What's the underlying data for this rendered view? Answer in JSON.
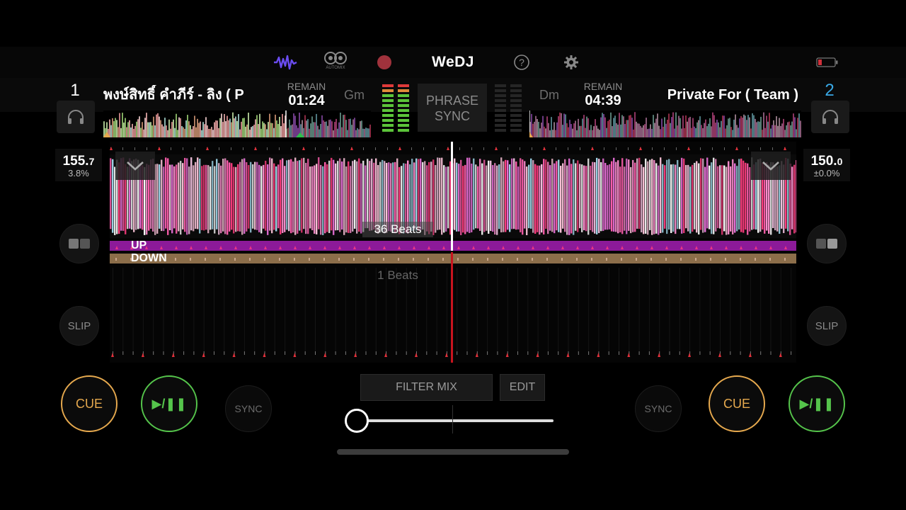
{
  "app": {
    "logo": "WeDJ",
    "automix_label": "AUTOMIX"
  },
  "colors": {
    "cue": "#e6a94e",
    "play": "#55c44b",
    "deck2_accent": "#39a9e6",
    "phrase_up": "#8c1a99",
    "phrase_down": "#8c6e4a",
    "playhead_lower": "#c8141e"
  },
  "icons": {
    "top": [
      "waveform-icon",
      "automix-icon",
      "record-icon",
      "help-icon",
      "settings-icon",
      "battery-icon"
    ],
    "deck": [
      "headphones-icon",
      "chevron-down-icon",
      "grid-icon"
    ]
  },
  "deck1": {
    "number": "1",
    "title": "พงษ์สิทธิ์ คำภีร์ - ลิง ( P",
    "remain_label": "REMAIN",
    "remain": "01:24",
    "key": "Gm",
    "bpm_main": "155.",
    "bpm_dec": "7",
    "pitch": "3.8%",
    "slip": "SLIP",
    "cue": "CUE",
    "play": "▶/❚❚",
    "sync": "SYNC"
  },
  "deck2": {
    "number": "2",
    "title": "Private For ( Team )",
    "remain_label": "REMAIN",
    "remain": "04:39",
    "key": "Dm",
    "bpm_main": "150.",
    "bpm_dec": "0",
    "pitch": "±0.0%",
    "slip": "SLIP",
    "cue": "CUE",
    "play": "▶/❚❚",
    "sync": "SYNC"
  },
  "center": {
    "phrase_line1": "PHRASE",
    "phrase_line2": "SYNC",
    "beats_upper": "36 Beats",
    "beats_lower": "1 Beats",
    "phrase_up": "UP",
    "phrase_down": "DOWN",
    "filter_mix": "FILTER MIX",
    "edit": "EDIT",
    "crossfader_position": 0.0
  }
}
